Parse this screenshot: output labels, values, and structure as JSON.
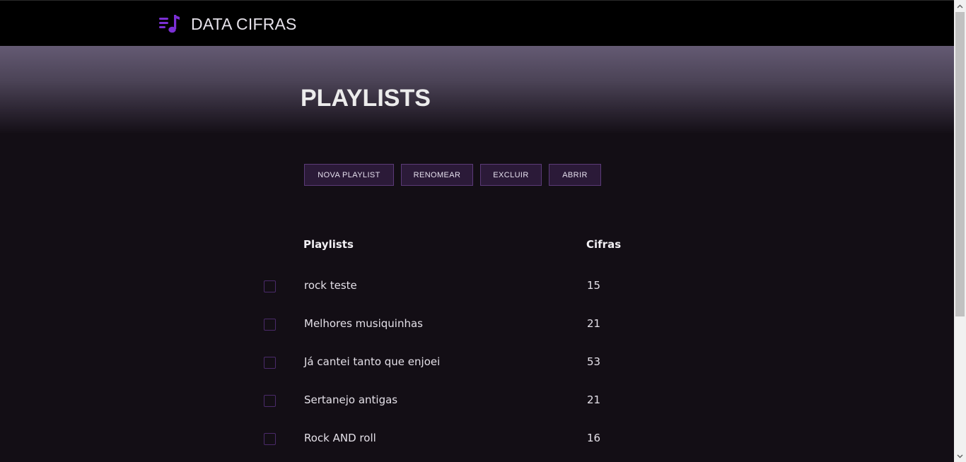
{
  "header": {
    "brand": "DATA CIFRAS",
    "icon": "playlist-music-icon",
    "accent_color": "#7b2fd4"
  },
  "page": {
    "title": "PLAYLISTS"
  },
  "toolbar": {
    "new_label": "NOVA PLAYLIST",
    "rename_label": "RENOMEAR",
    "delete_label": "EXCLUIR",
    "open_label": "ABRIR"
  },
  "table": {
    "headers": [
      "Playlists",
      "Cifras"
    ],
    "rows": [
      {
        "name": "rock teste",
        "count": "15"
      },
      {
        "name": "Melhores musiquinhas",
        "count": "21"
      },
      {
        "name": "Já cantei tanto que enjoei",
        "count": "53"
      },
      {
        "name": "Sertanejo antigas",
        "count": "21"
      },
      {
        "name": "Rock AND roll",
        "count": "16"
      }
    ]
  }
}
